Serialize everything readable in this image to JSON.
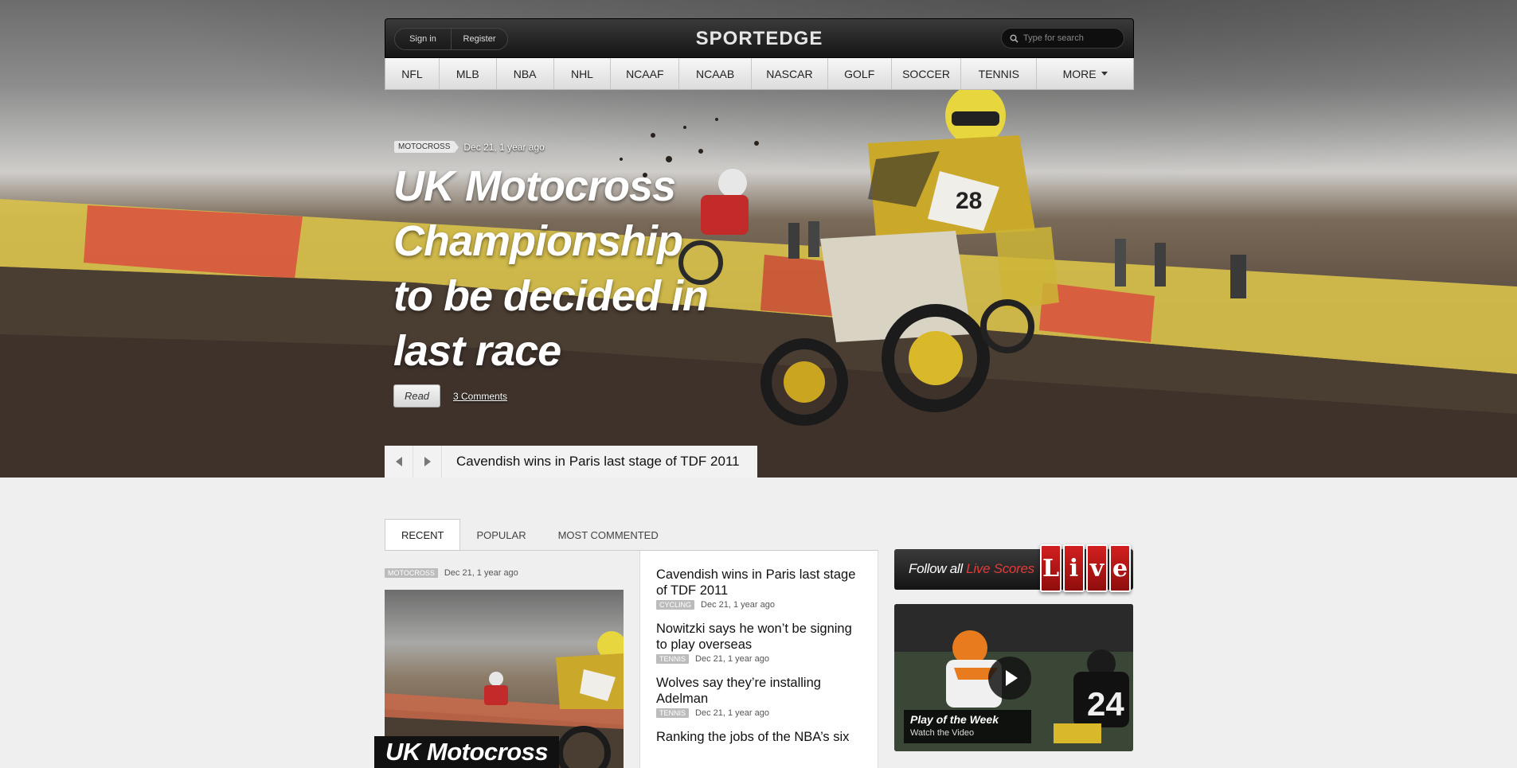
{
  "header": {
    "sign_in": "Sign in",
    "register": "Register",
    "logo": "SPORTEDGE",
    "search_placeholder": "Type for search"
  },
  "nav": {
    "items": [
      "NFL",
      "MLB",
      "NBA",
      "NHL",
      "NCAAF",
      "NCAAB",
      "NASCAR",
      "GOLF",
      "SOCCER",
      "TENNIS",
      "MORE"
    ]
  },
  "hero": {
    "tag": "MOTOCROSS",
    "date": "Dec 21, 1 year ago",
    "title": "UK Motocross Championship to be decided in last race",
    "read_label": "Read",
    "comments": "3 Comments",
    "rider_number": "28"
  },
  "slider": {
    "title": "Cavendish wins in Paris last stage of TDF 2011"
  },
  "tabs": [
    "RECENT",
    "POPULAR",
    "MOST COMMENTED"
  ],
  "feature": {
    "tag": "MOTOCROSS",
    "date": "Dec 21, 1 year ago",
    "caption": "UK Motocross"
  },
  "news": [
    {
      "title": "Cavendish wins in Paris last stage of TDF 2011",
      "tag": "CYCLING",
      "date": "Dec 21, 1 year ago"
    },
    {
      "title": "Nowitzki says he won’t be signing to play overseas",
      "tag": "TENNIS",
      "date": "Dec 21, 1 year ago"
    },
    {
      "title": "Wolves say they’re installing Adelman",
      "tag": "TENNIS",
      "date": "Dec 21, 1 year ago"
    },
    {
      "title": "Ranking the jobs of the NBA’s six",
      "tag": "",
      "date": ""
    }
  ],
  "live": {
    "prefix": "Follow all ",
    "highlight": "Live Scores",
    "letters": [
      "L",
      "i",
      "v",
      "e"
    ]
  },
  "video": {
    "title": "Play of the Week",
    "subtitle": "Watch the Video",
    "jersey_number": "24"
  }
}
